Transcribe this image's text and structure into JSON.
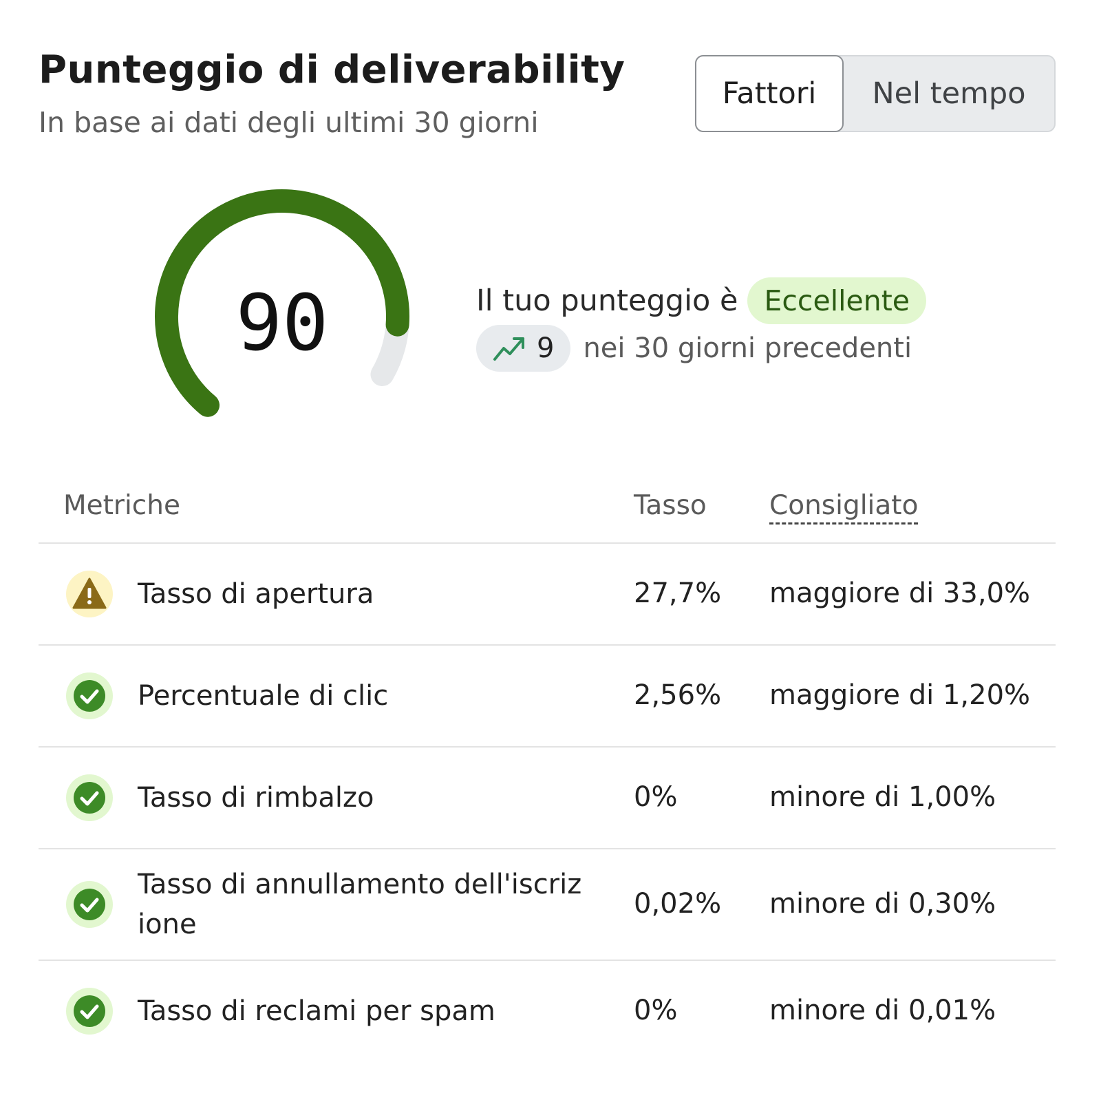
{
  "header": {
    "title": "Punteggio di deliverability",
    "subtitle": "In base ai dati degli ultimi 30 giorni"
  },
  "view_toggle": {
    "options": [
      "Fattori",
      "Nel tempo"
    ],
    "selected": "Fattori"
  },
  "score": {
    "value": "90",
    "max": 100,
    "label": "Il tuo punteggio è",
    "rating": "Eccellente",
    "change": "9",
    "change_direction": "up",
    "change_period": "nei 30 giorni precedenti"
  },
  "colors": {
    "gauge_fill": "#3a7414",
    "gauge_track": "#e6e8ea",
    "ok_icon": "#3d8b27",
    "warn_icon": "#8a6a18",
    "trend_icon": "#2f8f5b"
  },
  "table": {
    "headers": {
      "metric": "Metriche",
      "rate": "Tasso",
      "recommended": "Consigliato"
    },
    "rows": [
      {
        "status": "warning",
        "icon": "warning-icon",
        "name": "Tasso di apertura",
        "rate": "27,7%",
        "recommended": "maggiore di 33,0%"
      },
      {
        "status": "ok",
        "icon": "check-circle-icon",
        "name": "Percentuale di clic",
        "rate": "2,56%",
        "recommended": "maggiore di 1,20%"
      },
      {
        "status": "ok",
        "icon": "check-circle-icon",
        "name": "Tasso di rimbalzo",
        "rate": "0%",
        "recommended": "minore di 1,00%"
      },
      {
        "status": "ok",
        "icon": "check-circle-icon",
        "name": "Tasso di annullamento dell'iscriz\nione",
        "rate": "0,02%",
        "recommended": "minore di 0,30%"
      },
      {
        "status": "ok",
        "icon": "check-circle-icon",
        "name": "Tasso di reclami per spam",
        "rate": "0%",
        "recommended": "minore di 0,01%"
      }
    ]
  }
}
